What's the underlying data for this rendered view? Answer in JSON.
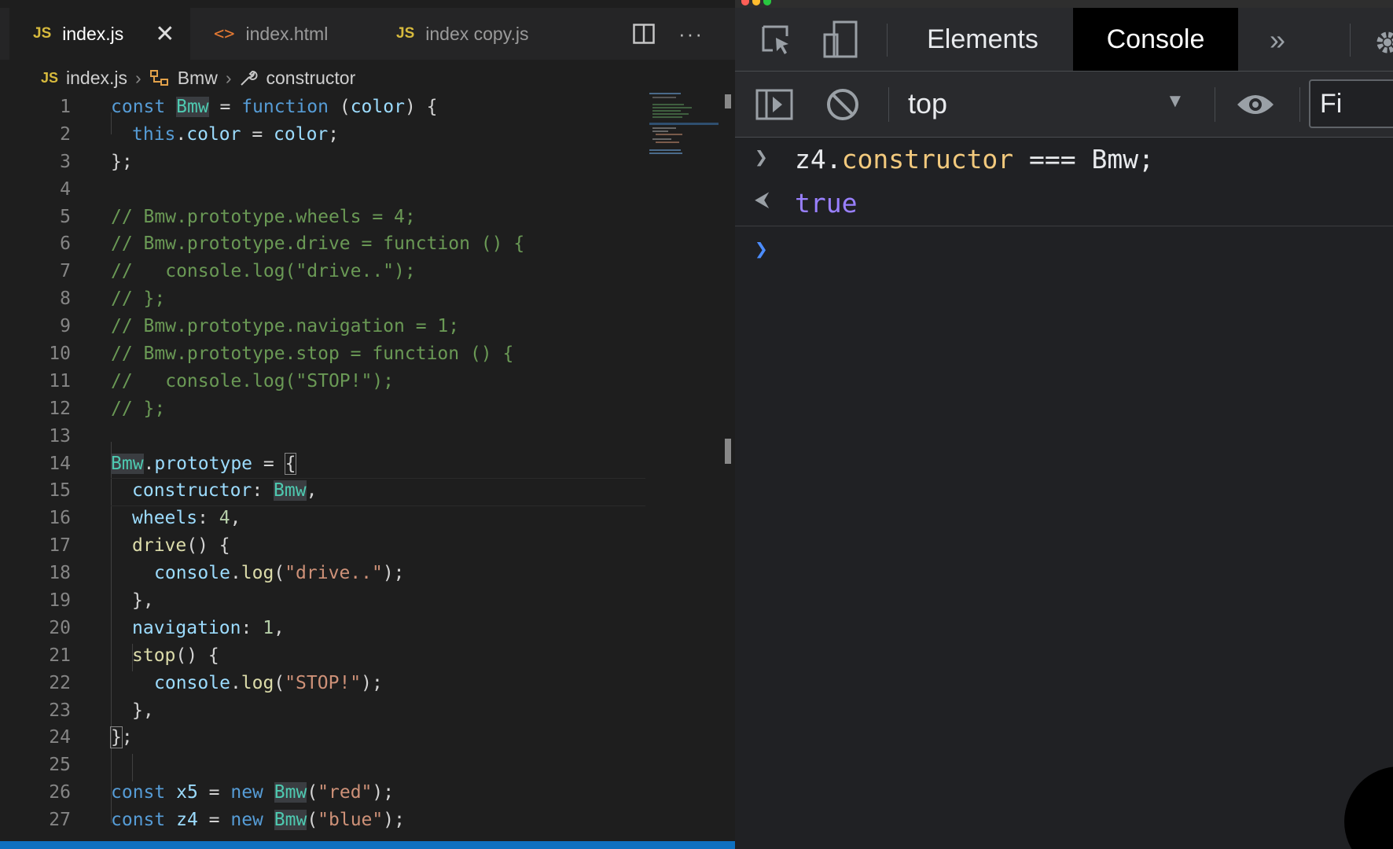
{
  "editor": {
    "tabs": [
      {
        "icon": "JS",
        "label": "index.js",
        "active": true
      },
      {
        "icon": "<>",
        "label": "index.html",
        "active": false
      },
      {
        "icon": "JS",
        "label": "index copy.js",
        "active": false
      }
    ],
    "breadcrumb": {
      "file_icon": "JS",
      "file": "index.js",
      "symbol": "Bmw",
      "member": "constructor"
    },
    "line_numbers": [
      "1",
      "2",
      "3",
      "4",
      "5",
      "6",
      "7",
      "8",
      "9",
      "10",
      "11",
      "12",
      "13",
      "14",
      "15",
      "16",
      "17",
      "18",
      "19",
      "20",
      "21",
      "22",
      "23",
      "24",
      "25",
      "26",
      "27"
    ],
    "code": {
      "l1": {
        "kw": "const",
        "name": "Bmw",
        "eq": " = ",
        "fkw": "function",
        "rest": " (",
        "param": "color",
        "end": ") {"
      },
      "l2": {
        "this": "this",
        "dot": ".",
        "prop": "color",
        "eq": " = ",
        "val": "color",
        "end": ";"
      },
      "l3": "};",
      "l5": "// Bmw.prototype.wheels = 4;",
      "l6": "// Bmw.prototype.drive = function () {",
      "l7": "//   console.log(\"drive..\");",
      "l8": "// };",
      "l9": "// Bmw.prototype.navigation = 1;",
      "l10": "// Bmw.prototype.stop = function () {",
      "l11": "//   console.log(\"STOP!\");",
      "l12": "// };",
      "l14": {
        "name": "Bmw",
        "dot": ".",
        "prop": "prototype",
        "eq": " = ",
        "brace": "{"
      },
      "l15": {
        "key": "constructor",
        "colon": ": ",
        "val": "Bmw",
        "end": ","
      },
      "l16": {
        "key": "wheels",
        "colon": ": ",
        "val": "4",
        "end": ","
      },
      "l17": {
        "fn": "drive",
        "end": "() {"
      },
      "l18": {
        "obj": "console",
        "dot": ".",
        "fn": "log",
        "open": "(",
        "str": "\"drive..\"",
        "end": ");"
      },
      "l19": "},",
      "l20": {
        "key": "navigation",
        "colon": ": ",
        "val": "1",
        "end": ","
      },
      "l21": {
        "fn": "stop",
        "end": "() {"
      },
      "l22": {
        "obj": "console",
        "dot": ".",
        "fn": "log",
        "open": "(",
        "str": "\"STOP!\"",
        "end": ");"
      },
      "l23": "},",
      "l24": {
        "brace": "}",
        "end": ";"
      },
      "l26": {
        "kw": "const",
        "name": "x5",
        "eq": " = ",
        "newkw": "new",
        "cls": "Bmw",
        "open": "(",
        "str": "\"red\"",
        "end": ");"
      },
      "l27": {
        "kw": "const",
        "name": "z4",
        "eq": " = ",
        "newkw": "new",
        "cls": "Bmw",
        "open": "(",
        "str": "\"blue\"",
        "end": ");"
      }
    }
  },
  "devtools": {
    "tabs": [
      "Elements",
      "Console"
    ],
    "context": "top",
    "filter_label": "Fi",
    "console": {
      "input": {
        "obj": "z4",
        "dot": ".",
        "prop": "constructor",
        "rest": " === Bmw;"
      },
      "output": "true"
    }
  }
}
